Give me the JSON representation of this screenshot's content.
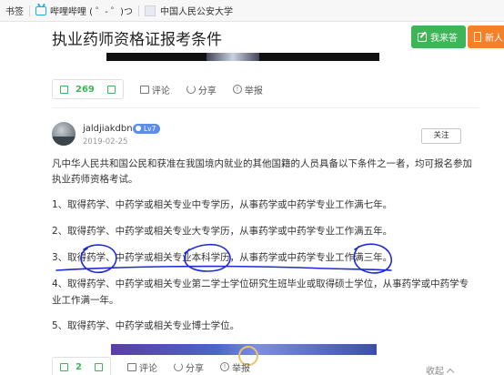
{
  "bookmarks": {
    "items": [
      "书签",
      "哔哩哔哩 ( ゜- ゜)つ",
      "中国人民公安大学"
    ]
  },
  "header": {
    "title": "执业药师资格证报考条件",
    "answer_button": "我来答",
    "new_button": "新人"
  },
  "question_actions": {
    "like_count": "269",
    "comment": "评论",
    "share": "分享",
    "report": "举报"
  },
  "answer": {
    "username": "jaldjiakdbn",
    "level": "Lv7",
    "date": "2019-02-25",
    "follow": "关注",
    "intro_line1": "凡中华人民共和国公民和获准在我国境内就业的其他国籍的人员具备以下条件之一者，均可报名参加",
    "intro_line2": "执业药师资格考试。",
    "item1": "1、取得药学、中药学或相关专业中专学历，从事药学或中药学专业工作满七年。",
    "item2": "2、取得药学、中药学或相关专业大专学历，从事药学或中药学专业工作满五年。",
    "item3": "3、取得药学、中药学或相关专业本科学历，从事药学或中药学专业工作满三年。",
    "item4_line1": "4、取得药学、中药学或相关专业第二学士学位研究生班毕业或取得硕士学位，从事药学或中药学专",
    "item4_line2": "业工作满一年。",
    "item5": "5、取得药学、中药学或相关专业博士学位。"
  },
  "answer_actions": {
    "like_count": "2",
    "comment": "评论",
    "share": "分享",
    "report": "举报",
    "fold": "收起"
  },
  "colors": {
    "brand_green": "#3db657",
    "orange": "#f4802a",
    "annotation_blue": "#1d2bd6"
  }
}
